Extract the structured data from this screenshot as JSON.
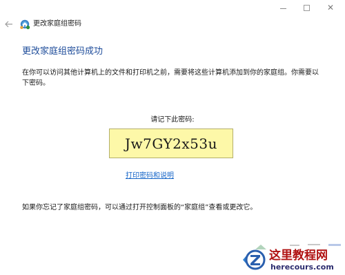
{
  "window": {
    "controls": {
      "minimize": "—",
      "maximize": "☐",
      "close": "✕"
    }
  },
  "nav": {
    "title": "更改家庭组密码"
  },
  "content": {
    "heading": "更改家庭组密码成功",
    "description": "在你可以访问其他计算机上的文件和打印机之前，需要将这些计算机添加到你的家庭组。你需要以下密码。",
    "password_label": "请记下此密码:",
    "password": "Jw7GY2x53u",
    "print_link": "打印密码和说明",
    "footer": "如果你忘记了家庭组密码，可以通过打开控制面板的“家庭组”查看或更改它。"
  },
  "watermark": {
    "title": "这里教程网",
    "url": "herecours.com"
  },
  "colors": {
    "heading": "#1e4c9a",
    "link": "#1565c8",
    "password_bg": "#fdf8a8",
    "watermark_title": "#b01212",
    "watermark_url": "#2b2b6e"
  },
  "icons": {
    "back": "back-arrow-icon",
    "homegroup": "homegroup-icon",
    "watermark_logo": "watermark-logo-icon"
  }
}
